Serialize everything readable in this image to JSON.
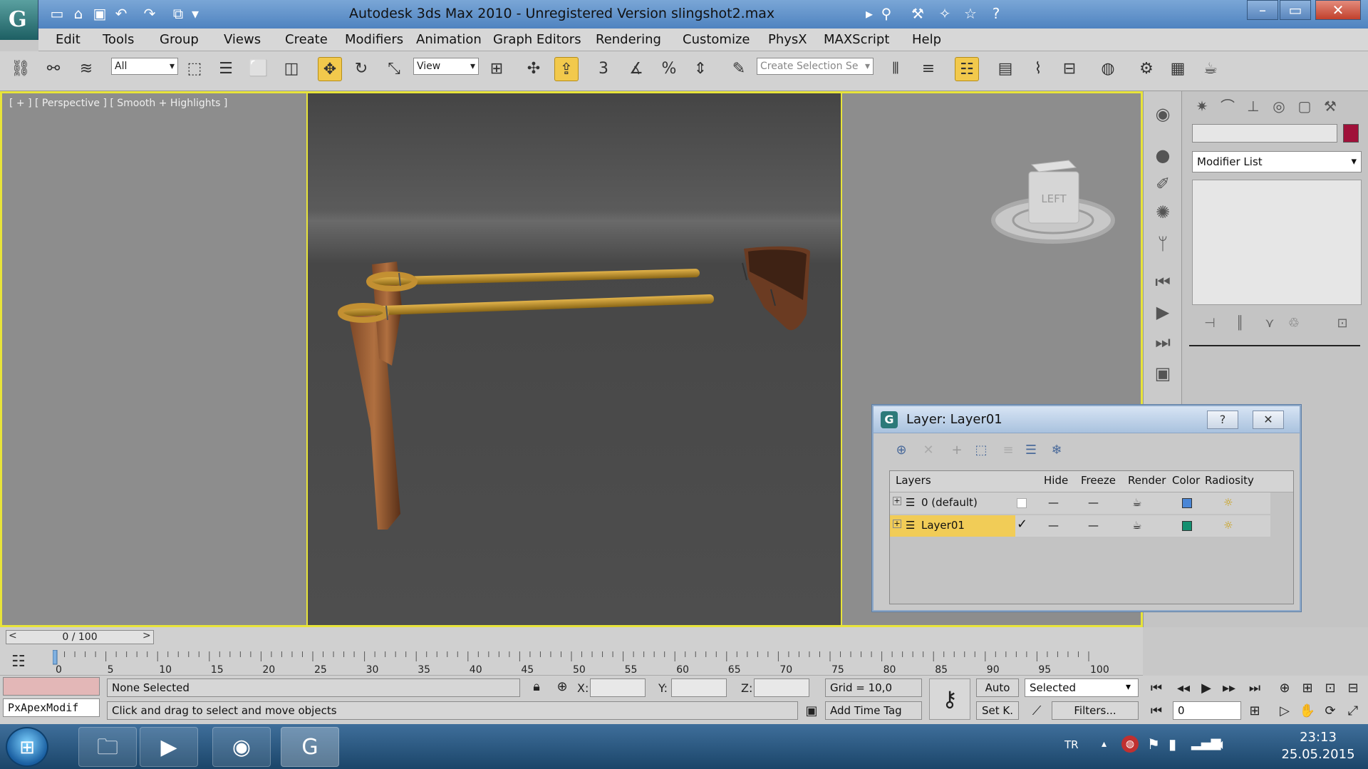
{
  "window": {
    "title": "Autodesk 3ds Max  2010  - Unregistered Version      slingshot2.max"
  },
  "menu": [
    "Edit",
    "Tools",
    "Group",
    "Views",
    "Create",
    "Modifiers",
    "Animation",
    "Graph Editors",
    "Rendering",
    "Customize",
    "PhysX",
    "MAXScript",
    "Help"
  ],
  "toolbar": {
    "selection_filter": "All",
    "reference_coord": "View",
    "snap_value": "3",
    "selection_set_placeholder": "Create Selection Se"
  },
  "viewport": {
    "label": "[ + ] [ Perspective ] [ Smooth + Highlights ]",
    "viewcube_face": "LEFT"
  },
  "command_panel": {
    "modifier_list": "Modifier List",
    "object_color": "#a0113a"
  },
  "timeline": {
    "frame_display": "0 / 100",
    "prev": "<",
    "next": ">",
    "ticks": [
      "0",
      "5",
      "10",
      "15",
      "20",
      "25",
      "30",
      "35",
      "40",
      "45",
      "50",
      "55",
      "60",
      "65",
      "70",
      "75",
      "80",
      "85",
      "90",
      "95",
      "100"
    ]
  },
  "status": {
    "listener_text": "PxApexModif",
    "selection": "None Selected",
    "prompt": "Click and drag to select and move objects",
    "x_label": "X:",
    "y_label": "Y:",
    "z_label": "Z:",
    "grid": "Grid = 10,0",
    "add_time_tag": "Add Time Tag",
    "auto_key": "Auto",
    "set_key": "Set K.",
    "key_filter": "Selected",
    "filters": "Filters...",
    "current_frame": "0"
  },
  "layer_dialog": {
    "title": "Layer: Layer01",
    "columns": [
      "Layers",
      "Hide",
      "Freeze",
      "Render",
      "Color",
      "Radiosity"
    ],
    "rows": [
      {
        "name": "0 (default)",
        "active": false,
        "color": "#4a86d6"
      },
      {
        "name": "Layer01",
        "active": true,
        "color": "#129070"
      }
    ]
  },
  "taskbar": {
    "lang": "TR",
    "time": "23:13",
    "date": "25.05.2015"
  }
}
